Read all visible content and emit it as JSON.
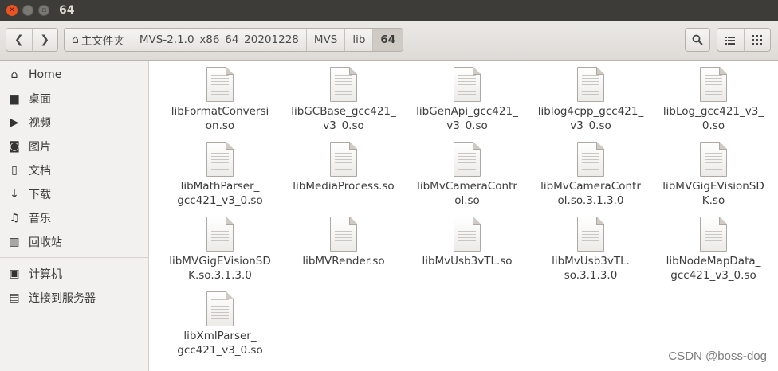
{
  "window": {
    "title": "64"
  },
  "path": {
    "home": "主文件夹",
    "crumbs": [
      "MVS-2.1.0_x86_64_20201228",
      "MVS",
      "lib",
      "64"
    ]
  },
  "sidebar": {
    "items": [
      {
        "label": "Home",
        "icon": "home-icon"
      },
      {
        "label": "桌面",
        "icon": "folder-icon"
      },
      {
        "label": "视频",
        "icon": "video-icon"
      },
      {
        "label": "图片",
        "icon": "camera-icon"
      },
      {
        "label": "文档",
        "icon": "document-icon"
      },
      {
        "label": "下载",
        "icon": "download-icon"
      },
      {
        "label": "音乐",
        "icon": "music-icon"
      },
      {
        "label": "回收站",
        "icon": "trash-icon"
      },
      {
        "label": "计算机",
        "icon": "computer-icon"
      },
      {
        "label": "连接到服务器",
        "icon": "server-icon"
      }
    ]
  },
  "files": [
    {
      "line1": "libFormatConversi",
      "line2": "on.so"
    },
    {
      "line1": "libGCBase_gcc421_",
      "line2": "v3_0.so"
    },
    {
      "line1": "libGenApi_gcc421_",
      "line2": "v3_0.so"
    },
    {
      "line1": "liblog4cpp_gcc421_",
      "line2": "v3_0.so"
    },
    {
      "line1": "libLog_gcc421_v3_",
      "line2": "0.so"
    },
    {
      "line1": "libMathParser_",
      "line2": "gcc421_v3_0.so"
    },
    {
      "line1": "libMediaProcess.so",
      "line2": ""
    },
    {
      "line1": "libMvCameraContr",
      "line2": "ol.so"
    },
    {
      "line1": "libMvCameraContr",
      "line2": "ol.so.3.1.3.0"
    },
    {
      "line1": "libMVGigEVisionSD",
      "line2": "K.so"
    },
    {
      "line1": "libMVGigEVisionSD",
      "line2": "K.so.3.1.3.0"
    },
    {
      "line1": "libMVRender.so",
      "line2": ""
    },
    {
      "line1": "libMvUsb3vTL.so",
      "line2": ""
    },
    {
      "line1": "libMvUsb3vTL.",
      "line2": "so.3.1.3.0"
    },
    {
      "line1": "libNodeMapData_",
      "line2": "gcc421_v3_0.so"
    },
    {
      "line1": "libXmlParser_",
      "line2": "gcc421_v3_0.so"
    }
  ],
  "watermark": "CSDN @boss-dog"
}
